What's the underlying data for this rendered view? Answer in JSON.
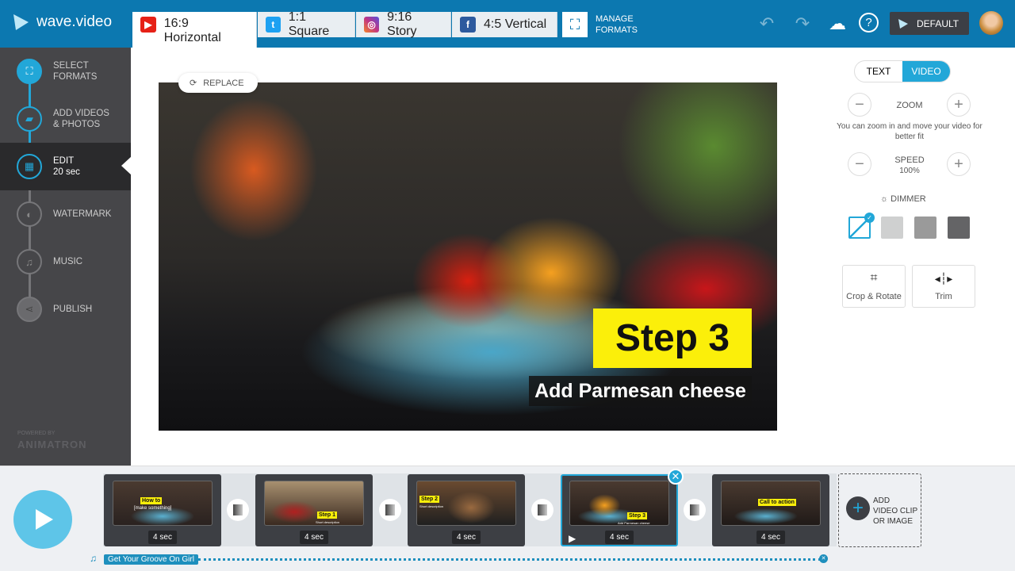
{
  "app": {
    "name": "wave.video"
  },
  "formats": [
    {
      "label": "16:9 Horizontal",
      "icon": "youtube-icon",
      "color": "#e62117",
      "active": true
    },
    {
      "label": "1:1 Square",
      "icon": "twitter-icon",
      "color": "#1da1f2",
      "active": false
    },
    {
      "label": "9:16 Story",
      "icon": "instagram-icon",
      "color": "#c13584",
      "active": false
    },
    {
      "label": "4:5 Vertical",
      "icon": "facebook-icon",
      "color": "#2d5a9e",
      "active": false
    }
  ],
  "header": {
    "manage_formats": "MANAGE\nFORMATS",
    "default_label": "DEFAULT"
  },
  "sidebar": {
    "steps": [
      {
        "label": "SELECT\nFORMATS",
        "icon": "select-formats-icon"
      },
      {
        "label": "ADD VIDEOS\n& PHOTOS",
        "icon": "folder-upload-icon"
      },
      {
        "label": "EDIT\n20 sec",
        "icon": "clapperboard-icon"
      },
      {
        "label": "WATERMARK",
        "icon": "drop-icon"
      },
      {
        "label": "MUSIC",
        "icon": "music-icon"
      },
      {
        "label": "PUBLISH",
        "icon": "share-icon"
      }
    ],
    "powered_by": "POWERED BY",
    "brand": "ANIMATRON"
  },
  "preview": {
    "replace": "REPLACE",
    "title": "Step 3",
    "subtitle": "Add Parmesan cheese"
  },
  "panel": {
    "tabs": [
      "TEXT",
      "VIDEO"
    ],
    "active_tab": "VIDEO",
    "zoom": "ZOOM",
    "zoom_hint": "You can zoom in and move your video for better fit",
    "speed": "SPEED",
    "speed_value": "100%",
    "dimmer": "DIMMER",
    "dimmer_options": [
      "none",
      "#cfd0d0",
      "#9a9a9a",
      "#646466"
    ],
    "crop": "Crop & Rotate",
    "trim": "Trim"
  },
  "timeline": {
    "clips": [
      {
        "duration": "4 sec",
        "label": "How to",
        "sub": "[make something]"
      },
      {
        "duration": "4 sec",
        "label": "Step 1",
        "sub": "Short description"
      },
      {
        "duration": "4 sec",
        "label": "Step 2",
        "sub": "Short description"
      },
      {
        "duration": "4 sec",
        "label": "Step 3",
        "sub": "Add Parmesan cheese",
        "selected": true
      },
      {
        "duration": "4 sec",
        "label": "Call to action",
        "sub": ""
      }
    ],
    "add_clip": "ADD\nVIDEO CLIP\nOR IMAGE",
    "music_track": "Get Your Groove On Girl"
  },
  "colors": {
    "accent": "#22a7d8",
    "topbar": "#0c78b0",
    "sidebar": "#464649"
  }
}
